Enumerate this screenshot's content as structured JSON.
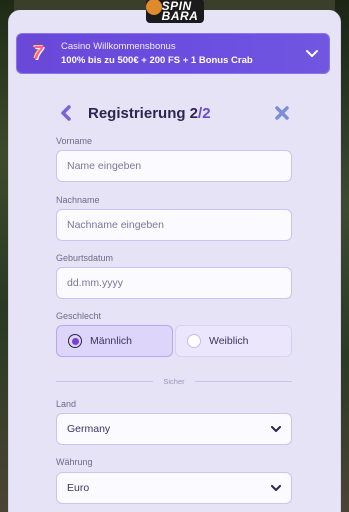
{
  "logo": {
    "text_line1": "SPIN",
    "text_line2": "BARA"
  },
  "promo": {
    "title": "Casino Willkommensbonus",
    "offer": "100% bis zu 500€ + 200 FS + 1 Bonus Crab",
    "icon": "7-slot-icon",
    "icon_glyph": "7"
  },
  "form": {
    "title_prefix": "Registrierung 2",
    "title_sep": "/",
    "title_total": "2",
    "first_name": {
      "label": "Vorname",
      "placeholder": "Name eingeben",
      "value": ""
    },
    "last_name": {
      "label": "Nachname",
      "placeholder": "Nachname eingeben",
      "value": ""
    },
    "birthdate": {
      "label": "Geburtsdatum",
      "placeholder": "dd.mm.yyyy",
      "value": ""
    },
    "gender": {
      "label": "Geschlecht",
      "options": [
        "Männlich",
        "Weiblich"
      ],
      "selected": "Männlich"
    },
    "divider_text": "Sicher",
    "country": {
      "label": "Land",
      "value": "Germany"
    },
    "currency": {
      "label": "Währung",
      "value": "Euro"
    }
  },
  "colors": {
    "accent": "#6a48d8",
    "panel_bg": "#e6e3f7",
    "promo_bg": "#6b4fe0"
  }
}
